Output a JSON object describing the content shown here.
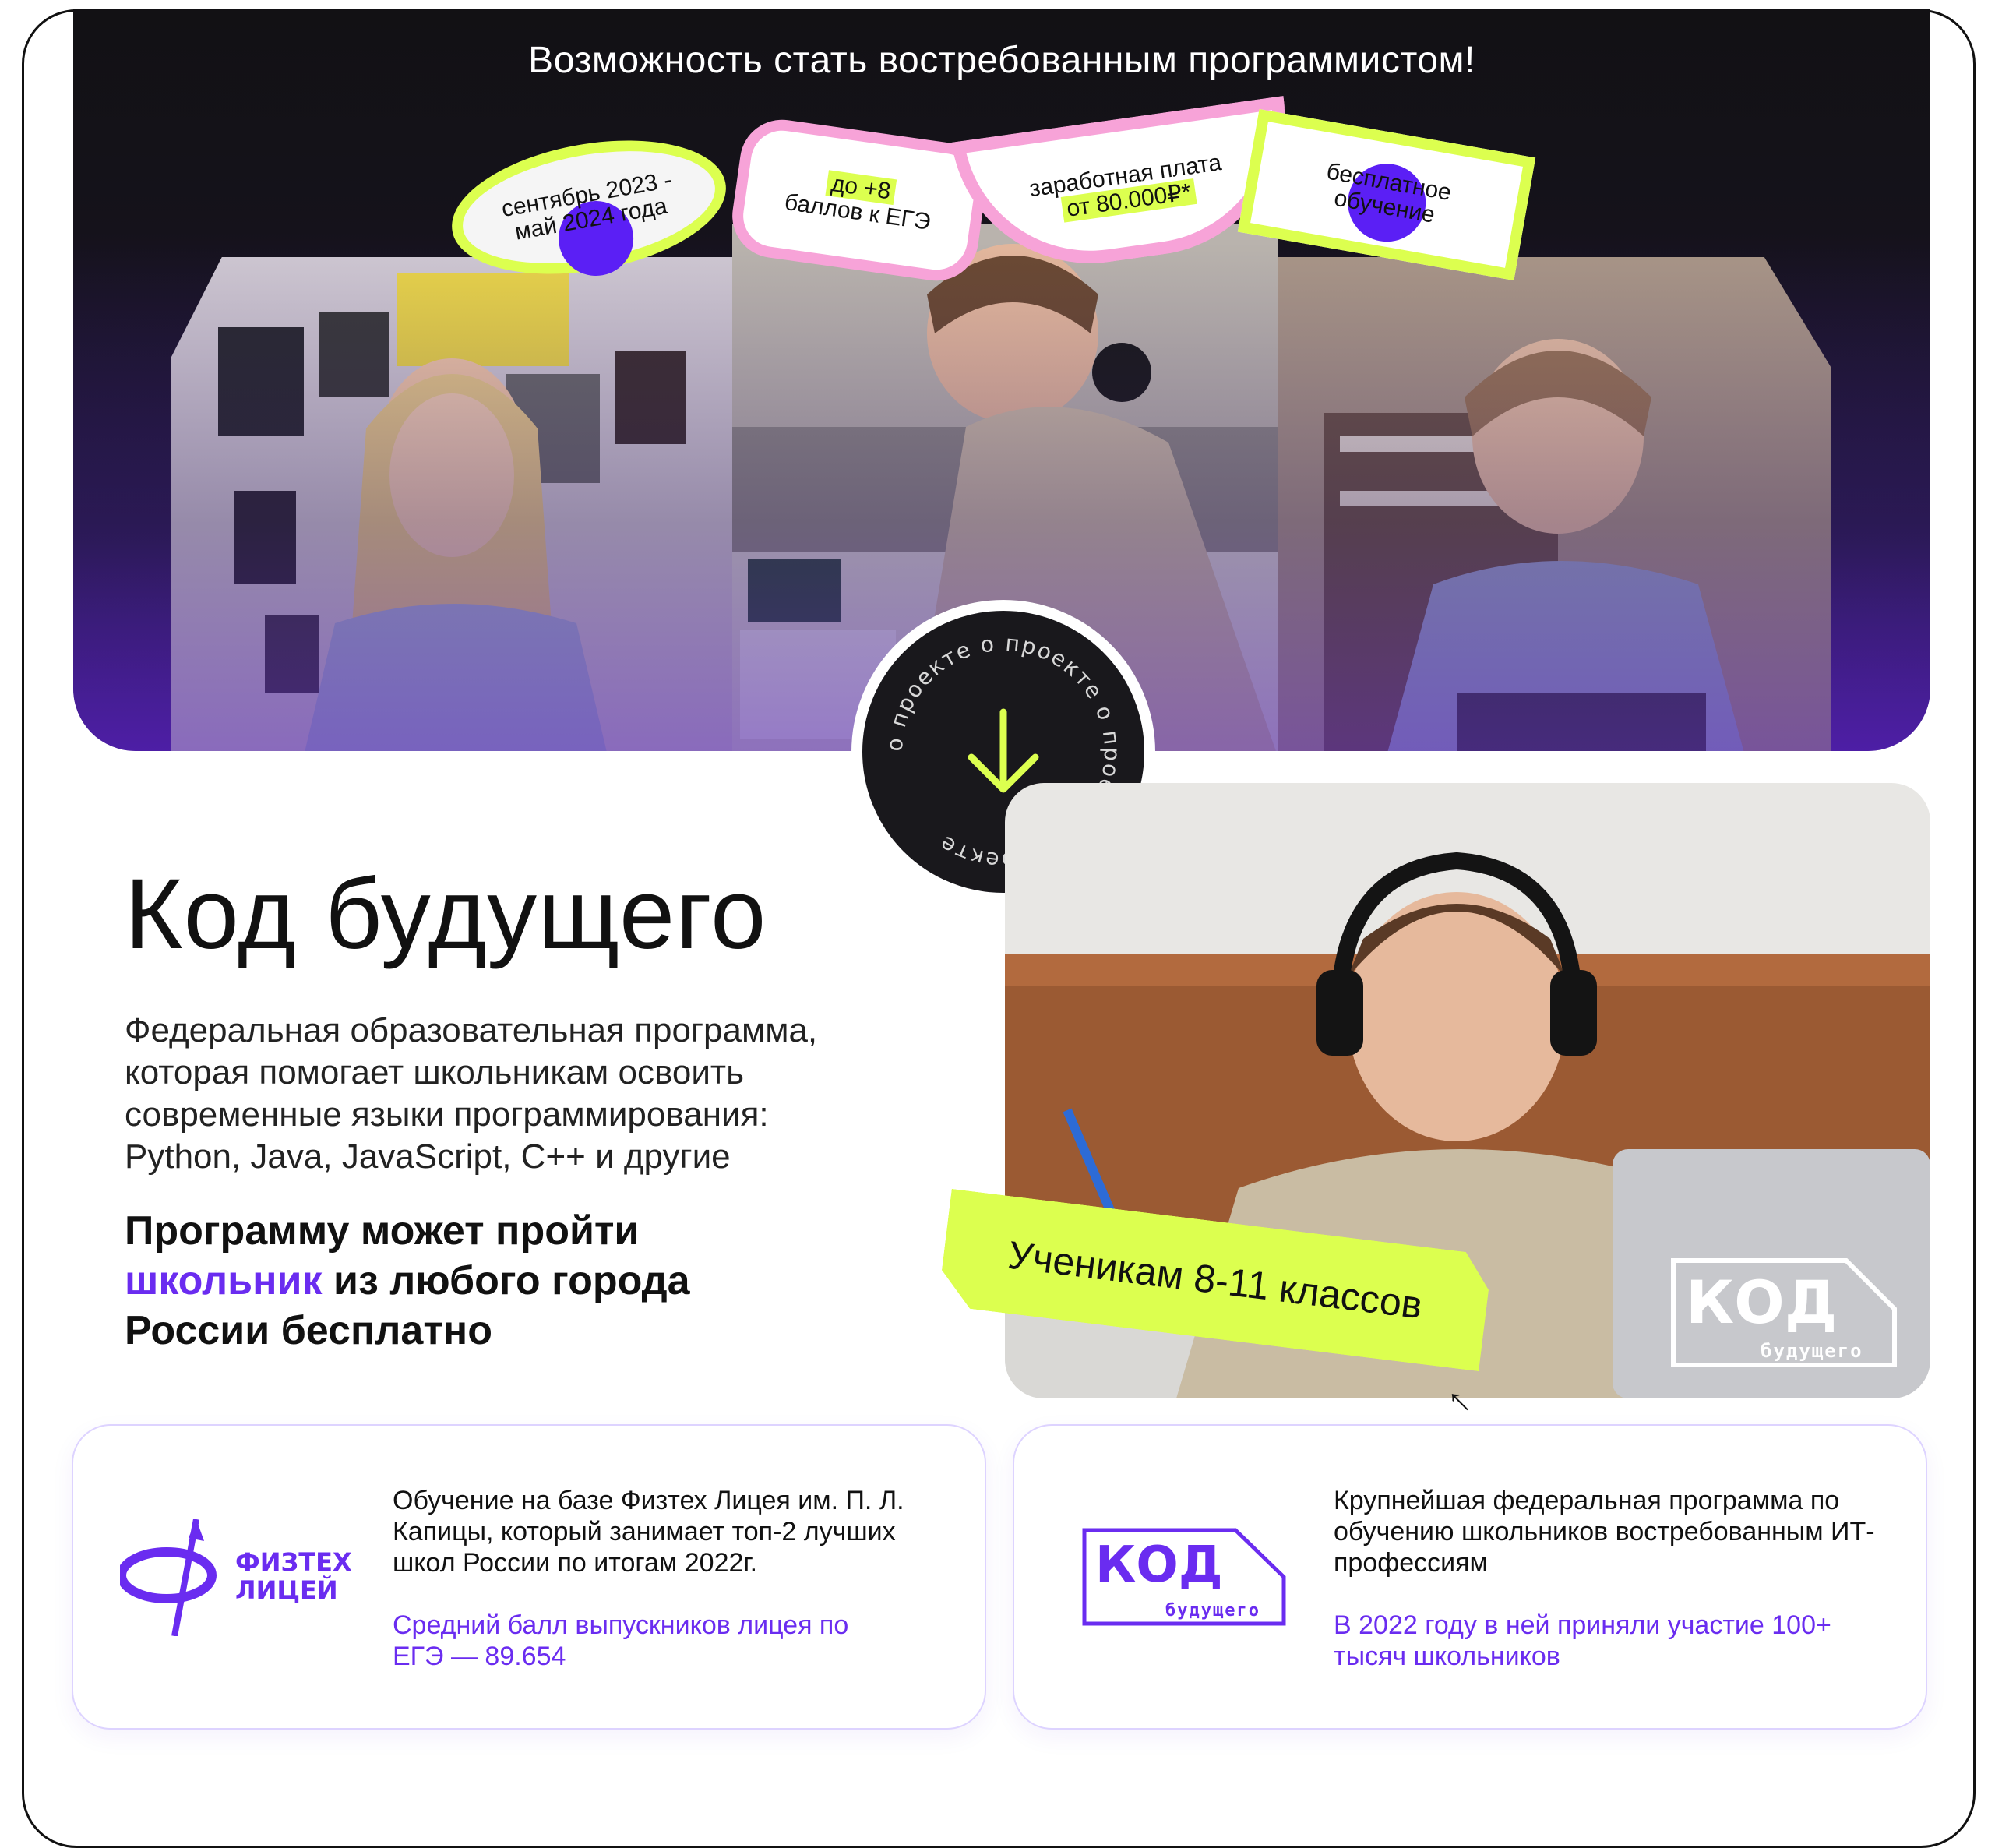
{
  "hero": {
    "title": "Возможность стать востребованным программистом!",
    "stickers": {
      "dates": "сентябрь 2023 - май 2024 года",
      "ege_line1": "до +8",
      "ege_line2": "баллов к ЕГЭ",
      "salary_line1": "заработная плата",
      "salary_line2": "от 80.000₽*",
      "free_line1": "бесплатное",
      "free_line2": "обучение"
    },
    "badge_ring_text": "о проекте о проекте о проекте о проекте "
  },
  "main": {
    "title": "Код будущего",
    "description": "Федеральная образовательная программа, которая помогает школьникам освоить современные языки программирования: Python, Java, JavaScript, C++ и другие",
    "lead_part1": "Программу может пройти",
    "lead_accent": "школьник",
    "lead_part2": "из любого города России бесплатно",
    "grade_tag": "Ученикам 8-11 классов",
    "logo_main": "КОД",
    "logo_sub": "будущего"
  },
  "cards": [
    {
      "logo_line1": "ФИЗТЕХ",
      "logo_line2": "ЛИЦЕЙ",
      "text": "Обучение на базе Физтех Лицея им. П. Л. Капицы, который занимает топ-2 лучших школ России по итогам 2022г.",
      "sub": "Средний балл выпускников лицея по ЕГЭ — 89.654"
    },
    {
      "logo_main": "КОД",
      "logo_sub": "будущего",
      "text": "Крупнейшая федеральная программа по обучению школьников востребованным ИТ-профессиям",
      "sub": "В 2022 году в ней приняли участие 100+ тысяч школьников"
    }
  ],
  "colors": {
    "accent_purple": "#6a2cf0",
    "lime": "#dcff4f",
    "pink": "#f7a3d8",
    "dark": "#19181c"
  }
}
